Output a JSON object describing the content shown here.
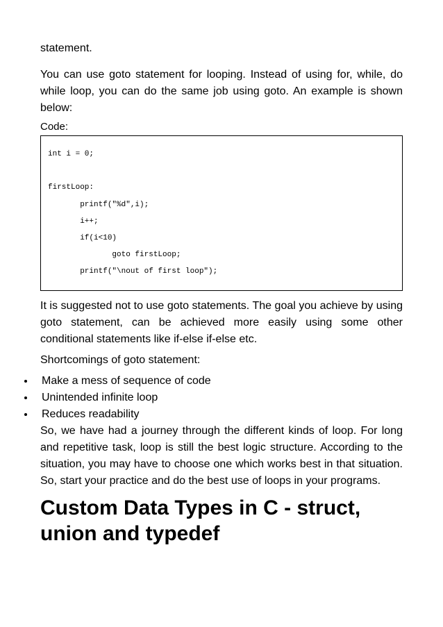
{
  "para1": "statement.",
  "para2": "You can use goto statement for looping. Instead of using for, while, do while loop, you can do the same job using goto. An example is shown below:",
  "codeLabel": "Code:",
  "code": "int i = 0;\n\nfirstLoop:\n       printf(\"%d\",i);\n       i++;\n       if(i<10)\n              goto firstLoop;\n       printf(\"\\nout of first loop\");",
  "para3": "It is suggested not to use goto statements. The goal you achieve by using goto statement, can be achieved more easily using some other conditional statements like if-else if-else etc.",
  "shortTitle": "Shortcomings of goto statement:",
  "bullets": [
    "Make a mess of sequence of code",
    "Unintended infinite loop",
    "Reduces readability"
  ],
  "para4": "So, we have had a journey through the different kinds of loop. For long and repetitive task, loop is still the best logic structure. According to the situation, you may have to choose one which works best in that situation. So, start your practice and do the best use of loops in your programs.",
  "heading": "Custom Data Types in C - struct, union and typedef"
}
